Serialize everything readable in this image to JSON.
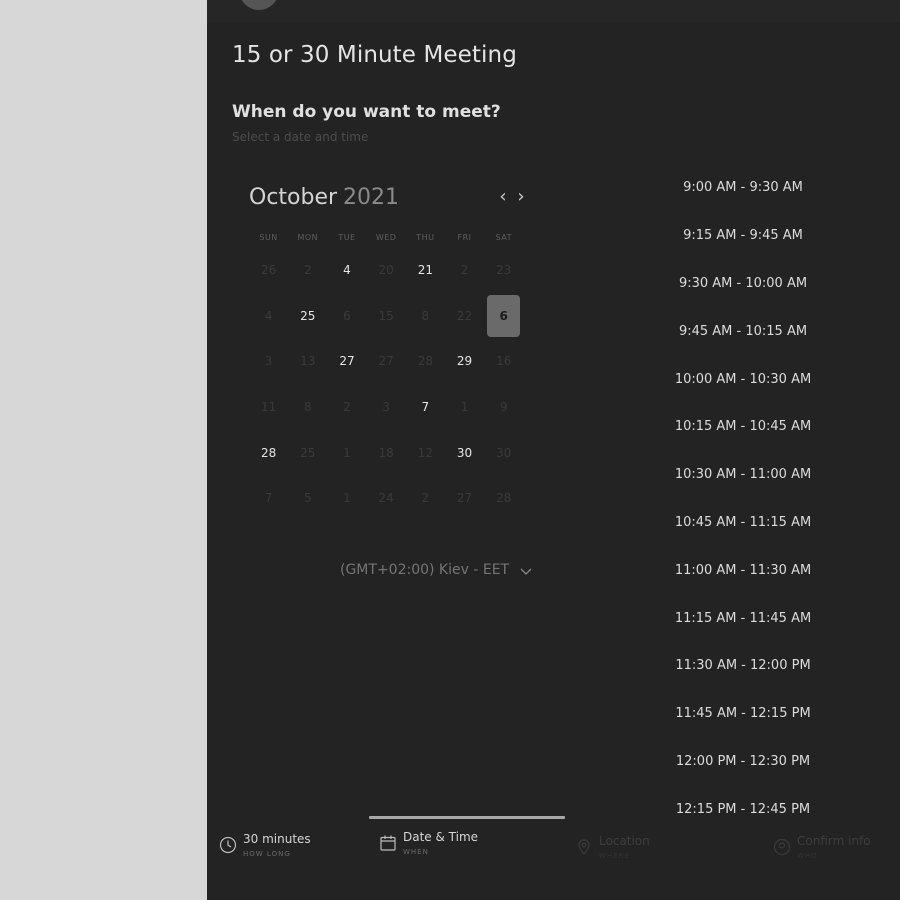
{
  "meeting": {
    "title": "15 or 30 Minute Meeting",
    "question": "When do you want to meet?",
    "subtitle": "Select a date and time"
  },
  "calendar": {
    "month": "October",
    "year": "2021",
    "prev_icon": "chevron-left-icon",
    "next_icon": "chevron-right-icon",
    "weekdays": [
      "SUN",
      "MON",
      "TUE",
      "WED",
      "THU",
      "FRI",
      "SAT"
    ],
    "weeks": [
      [
        {
          "d": "26",
          "a": false
        },
        {
          "d": "2",
          "a": false
        },
        {
          "d": "4",
          "a": true
        },
        {
          "d": "20",
          "a": false
        },
        {
          "d": "21",
          "a": true
        },
        {
          "d": "2",
          "a": false
        },
        {
          "d": "23",
          "a": false
        }
      ],
      [
        {
          "d": "4",
          "a": false
        },
        {
          "d": "25",
          "a": true
        },
        {
          "d": "6",
          "a": false
        },
        {
          "d": "15",
          "a": false
        },
        {
          "d": "8",
          "a": false
        },
        {
          "d": "22",
          "a": false
        },
        {
          "d": "6",
          "a": true,
          "s": true
        }
      ],
      [
        {
          "d": "3",
          "a": false
        },
        {
          "d": "13",
          "a": false
        },
        {
          "d": "27",
          "a": true
        },
        {
          "d": "27",
          "a": false
        },
        {
          "d": "28",
          "a": false
        },
        {
          "d": "29",
          "a": true
        },
        {
          "d": "16",
          "a": false
        }
      ],
      [
        {
          "d": "11",
          "a": false
        },
        {
          "d": "8",
          "a": false
        },
        {
          "d": "2",
          "a": false
        },
        {
          "d": "3",
          "a": false
        },
        {
          "d": "7",
          "a": true
        },
        {
          "d": "1",
          "a": false
        },
        {
          "d": "9",
          "a": false
        }
      ],
      [
        {
          "d": "28",
          "a": true
        },
        {
          "d": "25",
          "a": false
        },
        {
          "d": "1",
          "a": false
        },
        {
          "d": "18",
          "a": false
        },
        {
          "d": "12",
          "a": false
        },
        {
          "d": "30",
          "a": true
        },
        {
          "d": "30",
          "a": false
        }
      ],
      [
        {
          "d": "7",
          "a": false
        },
        {
          "d": "5",
          "a": false
        },
        {
          "d": "1",
          "a": false
        },
        {
          "d": "24",
          "a": false
        },
        {
          "d": "2",
          "a": false
        },
        {
          "d": "27",
          "a": false
        },
        {
          "d": "28",
          "a": false
        }
      ]
    ]
  },
  "timezone": {
    "label": "(GMT+02:00) Kiev - EET",
    "icon": "chevron-down-icon"
  },
  "time_slots": [
    "9:00 AM - 9:30 AM",
    "9:15 AM - 9:45 AM",
    "9:30 AM - 10:00 AM",
    "9:45 AM - 10:15 AM",
    "10:00 AM - 10:30 AM",
    "10:15 AM - 10:45 AM",
    "10:30 AM - 11:00 AM",
    "10:45 AM - 11:15 AM",
    "11:00 AM - 11:30 AM",
    "11:15 AM - 11:45 AM",
    "11:30 AM - 12:00 PM",
    "11:45 AM - 12:15 PM",
    "12:00 PM - 12:30 PM",
    "12:15 PM - 12:45 PM"
  ],
  "steps": [
    {
      "label": "30 minutes",
      "sub": "HOW LONG",
      "icon": "clock-icon",
      "state": "done"
    },
    {
      "label": "Date & Time",
      "sub": "WHEN",
      "icon": "calendar-icon",
      "state": "active"
    },
    {
      "label": "Location",
      "sub": "WHERE",
      "icon": "location-icon",
      "state": "pending"
    },
    {
      "label": "Confirm info",
      "sub": "WHO",
      "icon": "user-icon",
      "state": "pending"
    }
  ]
}
